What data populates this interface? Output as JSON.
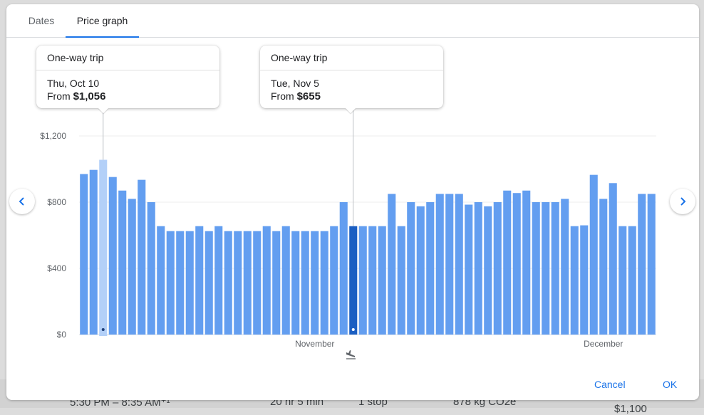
{
  "tabs": [
    {
      "label": "Dates",
      "active": false
    },
    {
      "label": "Price graph",
      "active": true
    }
  ],
  "tooltips": [
    {
      "title": "One-way trip",
      "date": "Thu, Oct 10",
      "from_label": "From",
      "price": "$1,056"
    },
    {
      "title": "One-way trip",
      "date": "Tue, Nov 5",
      "from_label": "From",
      "price": "$655"
    }
  ],
  "buttons": {
    "cancel": "Cancel",
    "ok": "OK"
  },
  "background_row": {
    "time": "5:30 PM – 8:35 AM⁺¹",
    "duration": "20 hr 5 min",
    "stops": "1 stop",
    "emissions": "878 kg CO2e",
    "price": "$1,100"
  },
  "colors": {
    "bar": "#639ef0",
    "bar_hover": "#b3d0f8",
    "bar_selected": "#1a5ec2",
    "accent": "#1a73e8"
  },
  "icons": {
    "prev": "chevron-left-icon",
    "next": "chevron-right-icon",
    "landing": "flight-land-icon"
  },
  "chart_data": {
    "type": "bar",
    "ylim": [
      0,
      1200
    ],
    "yticks": [
      {
        "value": 0,
        "label": "$0"
      },
      {
        "value": 400,
        "label": "$400"
      },
      {
        "value": 800,
        "label": "$800"
      },
      {
        "value": 1200,
        "label": "$1,200"
      }
    ],
    "month_labels": [
      {
        "label": "November",
        "index": 24
      },
      {
        "label": "December",
        "index": 54
      }
    ],
    "start_date": "Oct 8",
    "hover_index": 2,
    "selected_index": 28,
    "values": [
      970,
      995,
      1056,
      952,
      870,
      820,
      935,
      800,
      655,
      625,
      625,
      625,
      655,
      625,
      655,
      625,
      625,
      625,
      625,
      655,
      625,
      655,
      625,
      625,
      625,
      625,
      655,
      800,
      655,
      655,
      655,
      655,
      850,
      655,
      800,
      775,
      800,
      850,
      850,
      850,
      785,
      800,
      775,
      800,
      870,
      855,
      870,
      800,
      800,
      800,
      820,
      655,
      660,
      965,
      820,
      915,
      655,
      655,
      850,
      850
    ]
  }
}
